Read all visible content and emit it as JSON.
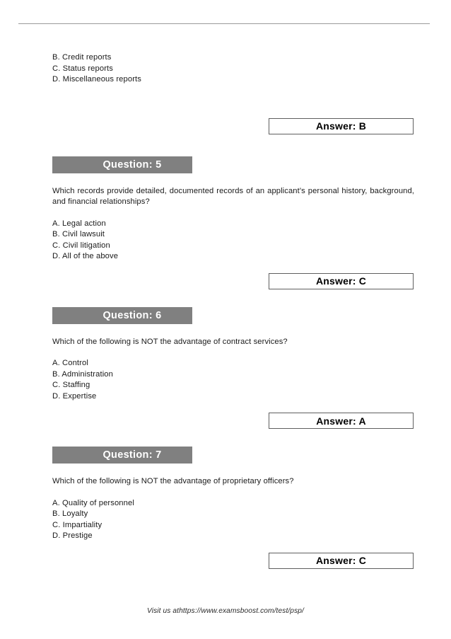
{
  "document": {
    "carryover_options": [
      "B. Credit reports",
      "C. Status reports",
      "D. Miscellaneous reports"
    ],
    "carryover_answer": "Answer: B",
    "questions": [
      {
        "header": "Question: 5",
        "text": "Which records provide detailed, documented records of an applicant’s personal history, background, and financial relationships?",
        "options": [
          "A. Legal action",
          "B. Civil lawsuit",
          "C. Civil litigation",
          "D. All of the above"
        ],
        "answer": "Answer: C"
      },
      {
        "header": "Question: 6",
        "text": "Which of the following is NOT the advantage of contract services?",
        "options": [
          "A. Control",
          "B. Administration",
          "C. Staffing",
          "D. Expertise"
        ],
        "answer": "Answer: A"
      },
      {
        "header": "Question: 7",
        "text": "Which of the following is NOT the advantage of proprietary officers?",
        "options": [
          "A. Quality of personnel",
          "B. Loyalty",
          "C. Impartiality",
          "D. Prestige"
        ],
        "answer": "Answer: C"
      }
    ],
    "footer": "Visit us athttps://www.examsboost.com/test/psp/"
  },
  "colors": {
    "header_bar": "#808080",
    "rule": "#9a9a9a",
    "answer_border": "#5f5f5f",
    "text": "#1a1a1a"
  }
}
